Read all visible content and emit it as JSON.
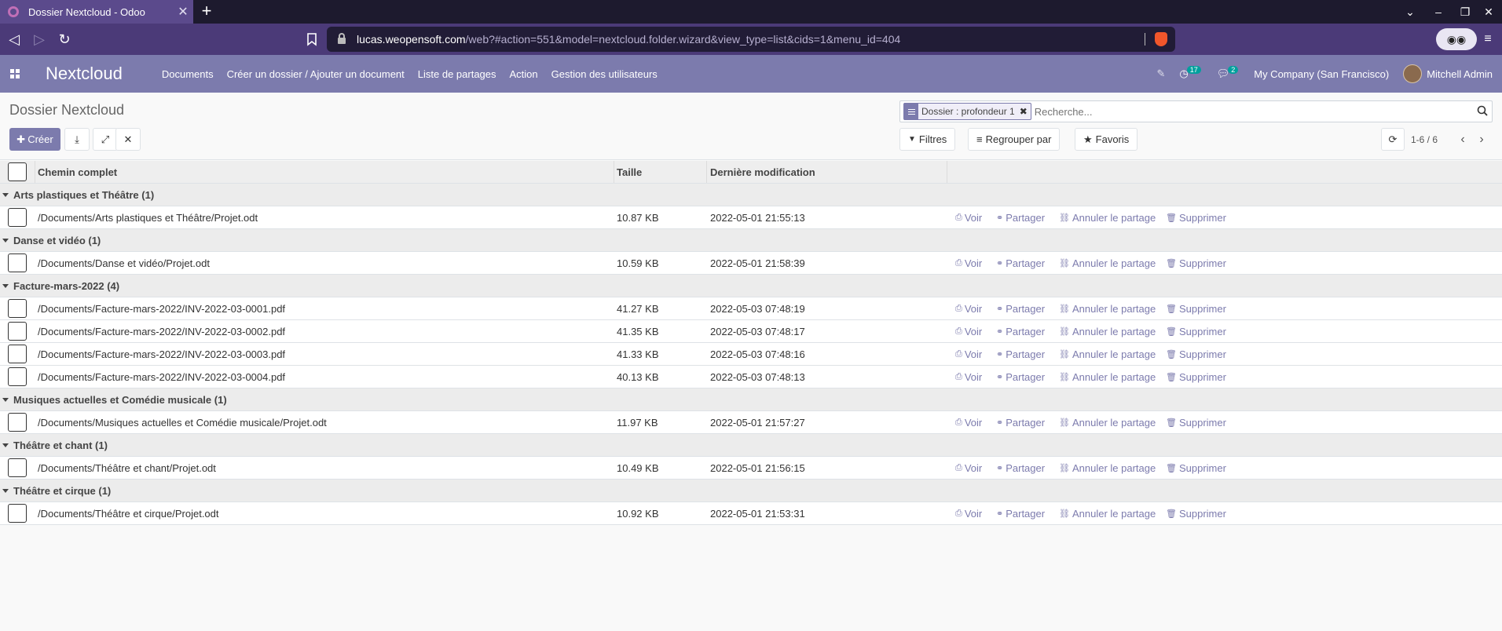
{
  "browser": {
    "tab_title": "Dossier Nextcloud - Odoo",
    "url_host": "lucas.weopensoft.com",
    "url_path": "/web?#action=551&model=nextcloud.folder.wizard&view_type=list&cids=1&menu_id=404"
  },
  "navbar": {
    "brand": "Nextcloud",
    "menu": [
      "Documents",
      "Créer un dossier / Ajouter un document",
      "Liste de partages",
      "Action",
      "Gestion des utilisateurs"
    ],
    "activity_count": "17",
    "messages_count": "2",
    "company": "My Company (San Francisco)",
    "user": "Mitchell Admin"
  },
  "control_panel": {
    "title": "Dossier Nextcloud",
    "create_label": "Créer",
    "facet": "Dossier : profondeur 1",
    "search_placeholder": "Recherche...",
    "filters_label": "Filtres",
    "groupby_label": "Regrouper par",
    "favorites_label": "Favoris",
    "pager": "1-6 / 6"
  },
  "table": {
    "headers": [
      "Chemin complet",
      "Taille",
      "Dernière modification"
    ],
    "actions": {
      "view": "Voir",
      "share": "Partager",
      "unshare": "Annuler le partage",
      "delete": "Supprimer"
    },
    "groups": [
      {
        "label": "Arts plastiques et Théâtre (1)",
        "rows": [
          {
            "path": "/Documents/Arts plastiques et Théâtre/Projet.odt",
            "size": "10.87 KB",
            "date": "2022-05-01 21:55:13"
          }
        ]
      },
      {
        "label": "Danse et vidéo (1)",
        "rows": [
          {
            "path": "/Documents/Danse et vidéo/Projet.odt",
            "size": "10.59 KB",
            "date": "2022-05-01 21:58:39"
          }
        ]
      },
      {
        "label": "Facture-mars-2022 (4)",
        "rows": [
          {
            "path": "/Documents/Facture-mars-2022/INV-2022-03-0001.pdf",
            "size": "41.27 KB",
            "date": "2022-05-03 07:48:19"
          },
          {
            "path": "/Documents/Facture-mars-2022/INV-2022-03-0002.pdf",
            "size": "41.35 KB",
            "date": "2022-05-03 07:48:17"
          },
          {
            "path": "/Documents/Facture-mars-2022/INV-2022-03-0003.pdf",
            "size": "41.33 KB",
            "date": "2022-05-03 07:48:16"
          },
          {
            "path": "/Documents/Facture-mars-2022/INV-2022-03-0004.pdf",
            "size": "40.13 KB",
            "date": "2022-05-03 07:48:13"
          }
        ]
      },
      {
        "label": "Musiques actuelles et Comédie musicale (1)",
        "rows": [
          {
            "path": "/Documents/Musiques actuelles et Comédie musicale/Projet.odt",
            "size": "11.97 KB",
            "date": "2022-05-01 21:57:27"
          }
        ]
      },
      {
        "label": "Théâtre et chant (1)",
        "rows": [
          {
            "path": "/Documents/Théâtre et chant/Projet.odt",
            "size": "10.49 KB",
            "date": "2022-05-01 21:56:15"
          }
        ]
      },
      {
        "label": "Théâtre et cirque (1)",
        "rows": [
          {
            "path": "/Documents/Théâtre et cirque/Projet.odt",
            "size": "10.92 KB",
            "date": "2022-05-01 21:53:31"
          }
        ]
      }
    ]
  },
  "colors": {
    "primary": "#7c7bad",
    "navbar": "#7c7bad",
    "browser": "#4b3a78"
  }
}
